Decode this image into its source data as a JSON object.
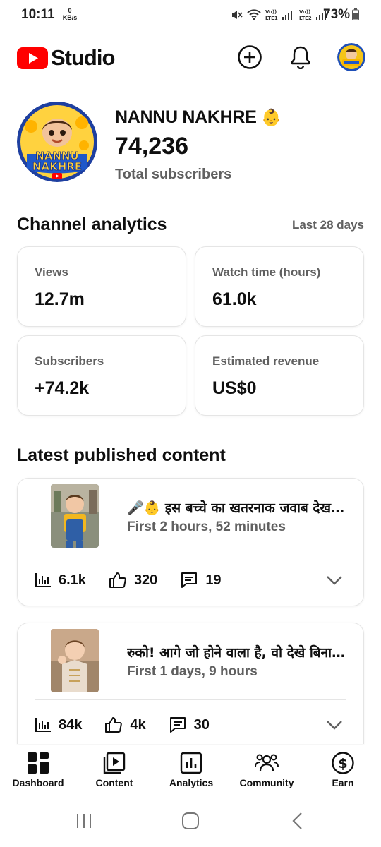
{
  "status_bar": {
    "time": "10:11",
    "net_speed_value": "0",
    "net_speed_unit": "KB/s",
    "sim1": "Vo)) LTE1",
    "sim2": "Vo)) LTE2",
    "battery": "73%"
  },
  "header": {
    "app_name": "Studio",
    "brand_color": "#ff0000"
  },
  "channel": {
    "name": "NANNU NAKHRE",
    "subscriber_count": "74,236",
    "subscriber_label": "Total subscribers",
    "avatar_text_line1": "NANNU",
    "avatar_text_line2": "NAKHRE"
  },
  "analytics": {
    "title": "Channel analytics",
    "range": "Last 28 days",
    "cards": [
      {
        "label": "Views",
        "value": "12.7m"
      },
      {
        "label": "Watch time (hours)",
        "value": "61.0k"
      },
      {
        "label": "Subscribers",
        "value": "+74.2k"
      },
      {
        "label": "Estimated revenue",
        "value": "US$0"
      }
    ]
  },
  "latest_content": {
    "title": "Latest published content",
    "videos": [
      {
        "title": "🎤👶 इस बच्चे का खतरनाक जवाब देखकर सब हैरान",
        "meta": "First 2 hours, 52 minutes",
        "views": "6.1k",
        "likes": "320",
        "comments": "19"
      },
      {
        "title": "रुको! आगे जो होने वाला है, वो देखे बिना मत जाना",
        "meta": "First 1 days, 9 hours",
        "views": "84k",
        "likes": "4k",
        "comments": "30"
      }
    ]
  },
  "bottom_nav": [
    {
      "label": "Dashboard",
      "icon": "dashboard-icon"
    },
    {
      "label": "Content",
      "icon": "content-icon"
    },
    {
      "label": "Analytics",
      "icon": "analytics-icon"
    },
    {
      "label": "Community",
      "icon": "community-icon"
    },
    {
      "label": "Earn",
      "icon": "earn-icon"
    }
  ]
}
